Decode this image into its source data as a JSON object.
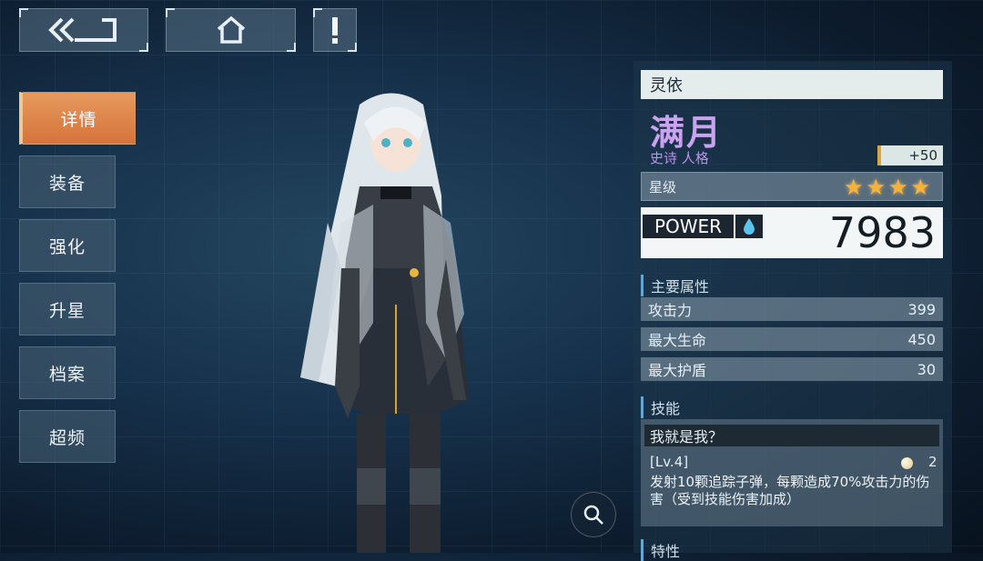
{
  "nav": {
    "back_icon": "back-arrow-icon",
    "home_icon": "home-icon",
    "alert_icon": "exclamation-icon"
  },
  "sidebar": {
    "items": [
      {
        "label": "详情",
        "active": true
      },
      {
        "label": "装备",
        "active": false
      },
      {
        "label": "强化",
        "active": false
      },
      {
        "label": "升星",
        "active": false
      },
      {
        "label": "档案",
        "active": false
      },
      {
        "label": "超频",
        "active": false
      }
    ]
  },
  "character": {
    "name": "灵依",
    "title": "满月",
    "rarity": "史诗 人格",
    "bonus": "+50",
    "star_label": "星级",
    "stars": 4,
    "power_label": "POWER",
    "power_value": "7983"
  },
  "attributes": {
    "header": "主要属性",
    "rows": [
      {
        "label": "攻击力",
        "value": "399"
      },
      {
        "label": "最大生命",
        "value": "450"
      },
      {
        "label": "最大护盾",
        "value": "30"
      }
    ]
  },
  "skill": {
    "header": "技能",
    "name": "我就是我？",
    "level": "[Lv.4]",
    "cost": "2",
    "description": "发射10颗追踪子弹，每颗造成70%攻击力的伤害（受到技能伤害加成）"
  },
  "traits_header": "特性",
  "colors": {
    "accent": "#d5733a",
    "title": "#c9a2f0",
    "star": "#f6b23a"
  }
}
